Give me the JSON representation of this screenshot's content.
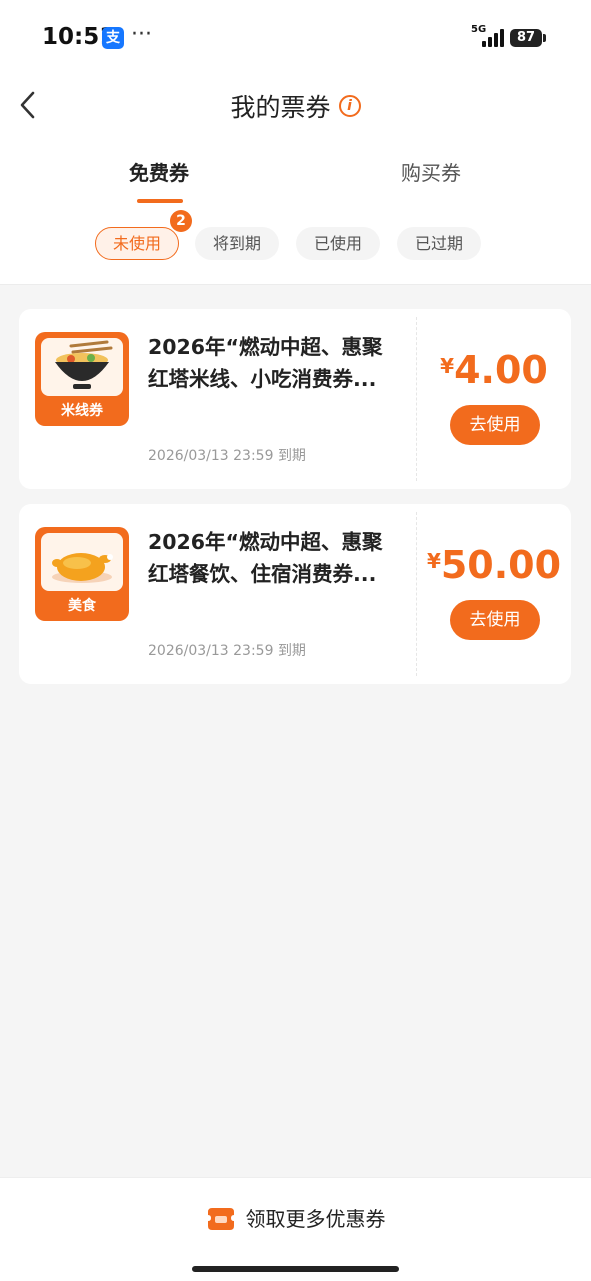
{
  "status": {
    "time": "10:51",
    "dots": "···",
    "network": "5G",
    "battery": "87"
  },
  "header": {
    "title": "我的票券",
    "info_icon": "i"
  },
  "tabs": [
    {
      "label": "免费券"
    },
    {
      "label": "购买券"
    }
  ],
  "filters": [
    {
      "label": "未使用",
      "badge": "2"
    },
    {
      "label": "将到期"
    },
    {
      "label": "已使用"
    },
    {
      "label": "已过期"
    }
  ],
  "coupons": [
    {
      "thumb_label": "米线券",
      "title": "2026年“燃动中超、惠聚红塔米线、小吃消费券...",
      "expire": "2026/03/13 23:59 到期",
      "currency": "¥",
      "amount": "4.00",
      "button": "去使用"
    },
    {
      "thumb_label": "美食",
      "title": "2026年“燃动中超、惠聚红塔餐饮、住宿消费券...",
      "expire": "2026/03/13 23:59 到期",
      "currency": "¥",
      "amount": "50.00",
      "button": "去使用"
    }
  ],
  "bottom": {
    "label": "领取更多优惠券"
  },
  "colors": {
    "accent": "#f26b1d",
    "background": "#f5f5f5"
  }
}
